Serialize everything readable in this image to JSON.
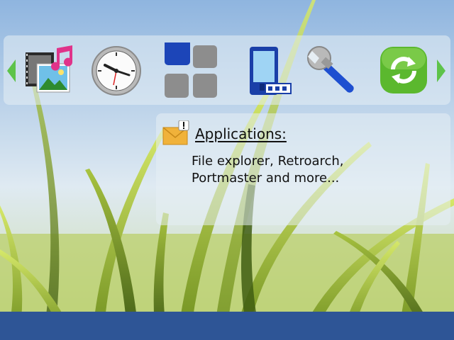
{
  "wallpaper": {
    "sky_top": "#8fb5df",
    "sky_bottom": "#e9f1f5",
    "grass": "#a8c838"
  },
  "app_bar": {
    "items": [
      {
        "icon": "media-gallery-icon"
      },
      {
        "icon": "clock-icon"
      },
      {
        "icon": "menu-grid-icon"
      },
      {
        "icon": "applications-phone-icon"
      },
      {
        "icon": "wrench-settings-icon"
      },
      {
        "icon": "sync-refresh-icon"
      }
    ],
    "arrow_color": "#5ec34a"
  },
  "info_panel": {
    "icon": "message-envelope-icon",
    "title": "Applications:",
    "description": "File explorer, Retroarch,\nPortmaster and more..."
  },
  "bottom_bar": {
    "color": "#2e5596"
  }
}
